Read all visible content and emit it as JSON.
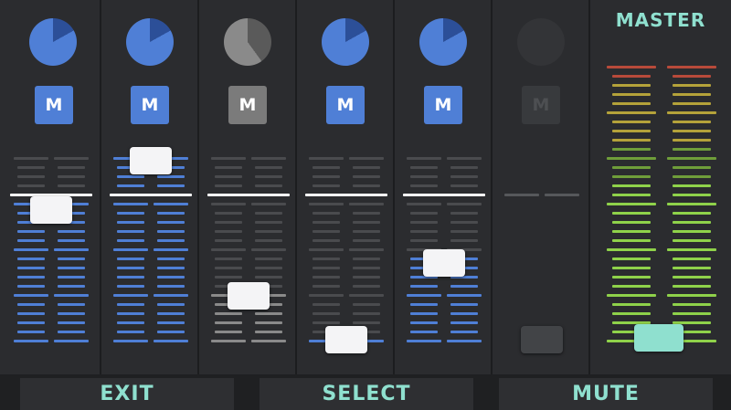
{
  "master": {
    "label": "MASTER",
    "level": 0.0
  },
  "mute_label": "M",
  "channels": [
    {
      "id": 1,
      "pan": 0.17,
      "active": true,
      "level": 0.71
    },
    {
      "id": 2,
      "pan": 0.17,
      "active": true,
      "level": 0.98
    },
    {
      "id": 3,
      "pan": 0.4,
      "active": false,
      "level": 0.24
    },
    {
      "id": 4,
      "pan": 0.17,
      "active": true,
      "level": 0.0
    },
    {
      "id": 5,
      "pan": 0.17,
      "active": true,
      "level": 0.42
    },
    {
      "id": 6,
      "pan": 0.0,
      "active": false,
      "disabled": true,
      "level": 0.0
    }
  ],
  "bottom_buttons": {
    "exit": "EXIT",
    "select": "SELECT",
    "mute": "MUTE"
  },
  "colors": {
    "accent": "#8fe0cf",
    "channel_blue": "#4f7fd6",
    "knob_wedge": "#2c4f98",
    "inactive_gray": "#8a8a8a",
    "meter_green": "#8fd24a",
    "meter_yellow": "#b4a23a",
    "meter_red": "#b84a3a"
  }
}
